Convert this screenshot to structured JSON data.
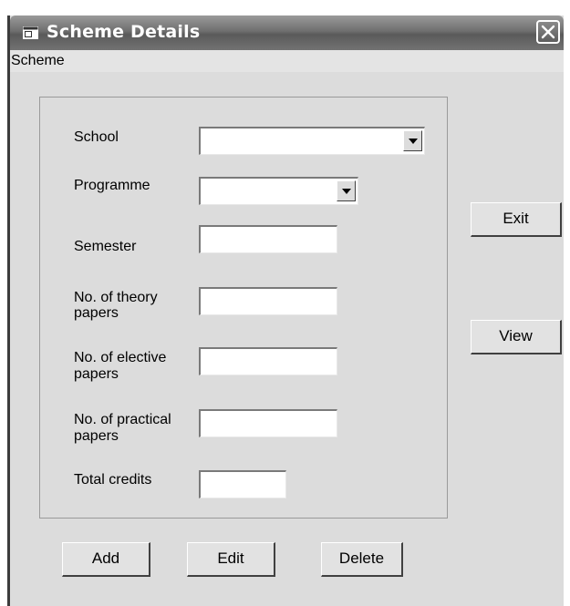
{
  "window": {
    "title": "Scheme Details",
    "close_glyph": "✕"
  },
  "menu": {
    "items": [
      "Scheme"
    ]
  },
  "form": {
    "school": {
      "label": "School",
      "value": ""
    },
    "programme": {
      "label": "Programme",
      "value": ""
    },
    "semester": {
      "label": "Semester",
      "value": ""
    },
    "theory_papers": {
      "label_line1": "No. of theory",
      "label_line2": "papers",
      "value": ""
    },
    "elective_papers": {
      "label_line1": "No. of elective",
      "label_line2": "papers",
      "value": ""
    },
    "practical_papers": {
      "label_line1": "No. of practical",
      "label_line2": "papers",
      "value": ""
    },
    "total_credits": {
      "label": "Total credits",
      "value": ""
    }
  },
  "side_buttons": {
    "exit": "Exit",
    "view": "View"
  },
  "bottom_buttons": {
    "add": "Add",
    "edit": "Edit",
    "delete": "Delete"
  },
  "icons": {
    "window": "window-app-icon",
    "close": "close-icon",
    "dropdown": "chevron-down-icon"
  }
}
